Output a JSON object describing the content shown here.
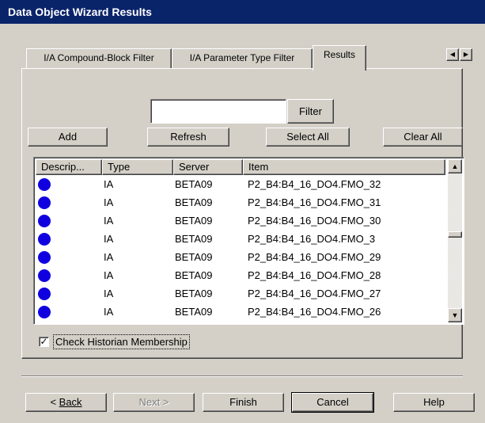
{
  "window": {
    "title": "Data Object Wizard Results"
  },
  "tabs": [
    {
      "label": "I/A Compound-Block Filter"
    },
    {
      "label": "I/A Parameter Type Filter"
    },
    {
      "label": "Results"
    }
  ],
  "filter": {
    "value": "",
    "button_label": "Filter"
  },
  "actions": {
    "add_label": "Add",
    "refresh_label": "Refresh",
    "select_all_label": "Select All",
    "clear_all_label": "Clear All"
  },
  "list": {
    "columns": [
      "Descrip...",
      "Type",
      "Server",
      "Item"
    ],
    "rows": [
      {
        "type": "IA",
        "server": "BETA09",
        "item": "P2_B4:B4_16_DO4.FMO_32"
      },
      {
        "type": "IA",
        "server": "BETA09",
        "item": "P2_B4:B4_16_DO4.FMO_31"
      },
      {
        "type": "IA",
        "server": "BETA09",
        "item": "P2_B4:B4_16_DO4.FMO_30"
      },
      {
        "type": "IA",
        "server": "BETA09",
        "item": "P2_B4:B4_16_DO4.FMO_3"
      },
      {
        "type": "IA",
        "server": "BETA09",
        "item": "P2_B4:B4_16_DO4.FMO_29"
      },
      {
        "type": "IA",
        "server": "BETA09",
        "item": "P2_B4:B4_16_DO4.FMO_28"
      },
      {
        "type": "IA",
        "server": "BETA09",
        "item": "P2_B4:B4_16_DO4.FMO_27"
      },
      {
        "type": "IA",
        "server": "BETA09",
        "item": "P2_B4:B4_16_DO4.FMO_26"
      }
    ]
  },
  "historian": {
    "label": "Check Historian Membership",
    "checked": true
  },
  "footer": {
    "back_label": "Back",
    "back_prefix": "< ",
    "next_label": "Next >",
    "finish_label": "Finish",
    "cancel_label": "Cancel",
    "help_label": "Help"
  },
  "colors": {
    "title_bg": "#0a246a",
    "status_dot": "#1000e0",
    "face": "#d4d0c8"
  },
  "icons": [
    "tab-left-arrow-icon",
    "tab-right-arrow-icon",
    "scroll-up-icon",
    "scroll-down-icon",
    "status-dot-icon",
    "checkmark-icon"
  ]
}
